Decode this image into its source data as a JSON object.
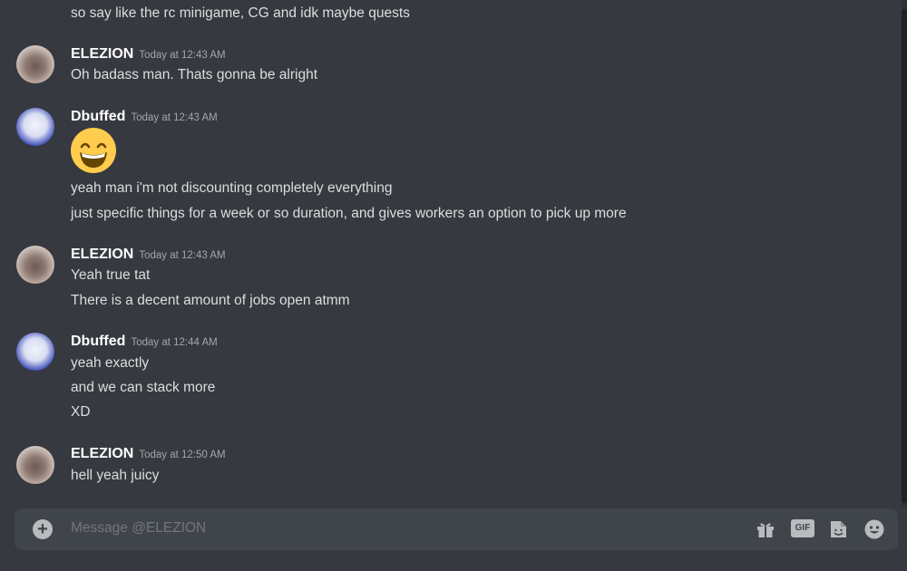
{
  "top_line": "so say like the rc minigame, CG and idk maybe quests",
  "groups": [
    {
      "author": "ELEZION",
      "timestamp": "Today at 12:43 AM",
      "lines": [
        "Oh badass man. Thats gonna be alright"
      ]
    },
    {
      "author": "Dbuffed",
      "timestamp": "Today at 12:43 AM",
      "emoji": "grinning-face-with-smiling-eyes",
      "lines": [
        "yeah man i'm not discounting completely everything",
        "just specific things for a week or so duration, and gives workers an option to pick up more"
      ]
    },
    {
      "author": "ELEZION",
      "timestamp": "Today at 12:43 AM",
      "lines": [
        "Yeah true tat",
        "There is a decent amount of jobs open atmm"
      ]
    },
    {
      "author": "Dbuffed",
      "timestamp": "Today at 12:44 AM",
      "lines": [
        "yeah exactly",
        "and we can stack more",
        "XD"
      ]
    },
    {
      "author": "ELEZION",
      "timestamp": "Today at 12:50 AM",
      "lines": [
        "hell yeah juicy"
      ]
    }
  ],
  "composer": {
    "placeholder": "Message @ELEZION",
    "gif_label": "GIF"
  },
  "colors": {
    "background": "#36393f",
    "input_background": "#40444b",
    "username": "#ffffff",
    "timestamp": "#a3a6aa",
    "text": "#dcddde"
  },
  "icons": [
    "add-attachment-icon",
    "gift-icon",
    "gif-icon",
    "sticker-icon",
    "emoji-icon"
  ]
}
